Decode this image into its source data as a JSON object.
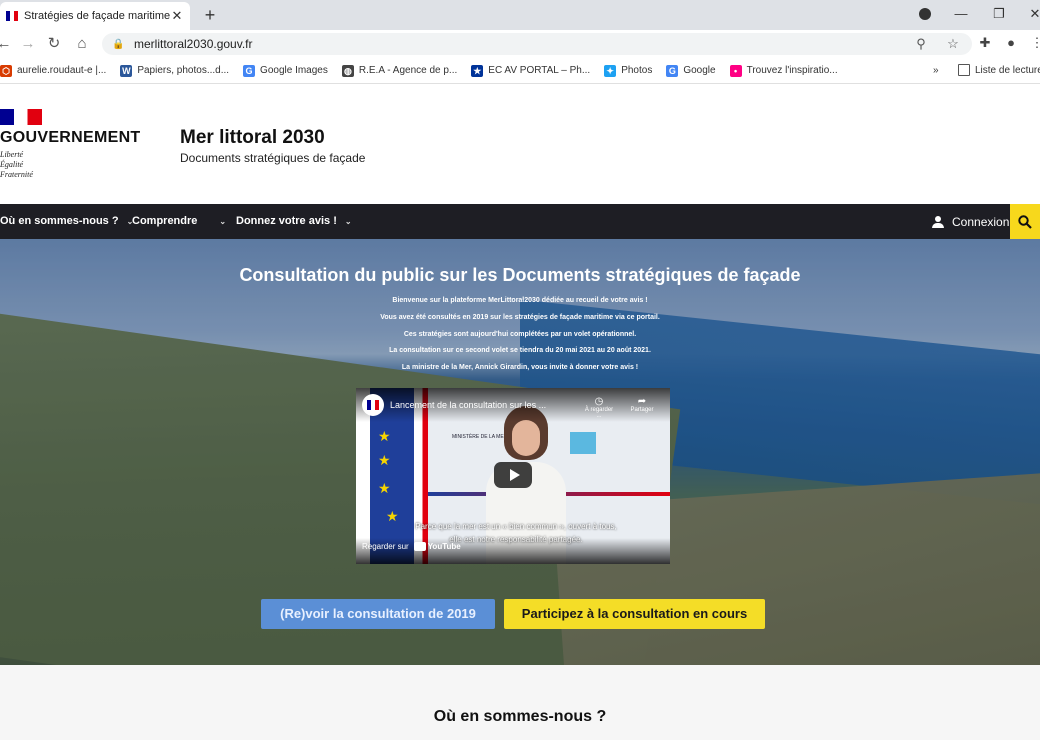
{
  "browser": {
    "tab_title": "Stratégies de façade maritime |",
    "tab_close": "✕",
    "new_tab": "+",
    "url": "merlittoral2030.gouv.fr",
    "bookmarks": [
      {
        "label": "aurelie.roudaut-e |...",
        "icon": "outlook-icon",
        "color": "#d83b01",
        "glyph": "⬡"
      },
      {
        "label": "Papiers, photos...d...",
        "icon": "word-icon",
        "color": "#2b579a",
        "glyph": "W"
      },
      {
        "label": "Google Images",
        "icon": "google-icon",
        "color": "#4285f4",
        "glyph": "G"
      },
      {
        "label": "R.E.A - Agence de p...",
        "icon": "globe-icon",
        "color": "#444444",
        "glyph": "◍"
      },
      {
        "label": "EC AV PORTAL – Ph...",
        "icon": "eu-icon",
        "color": "#003399",
        "glyph": "★"
      },
      {
        "label": "Photos",
        "icon": "twitter-icon",
        "color": "#1da1f2",
        "glyph": "✦"
      },
      {
        "label": "Google",
        "icon": "google-icon",
        "color": "#4285f4",
        "glyph": "G"
      },
      {
        "label": "Trouvez l'inspiratio...",
        "icon": "flickr-icon",
        "color": "#ff0084",
        "glyph": "•"
      }
    ],
    "bookmarks_more": "»",
    "reading_list": "Liste de lecture"
  },
  "header": {
    "gov_name": "GOUVERNEMENT",
    "motto_1": "Liberté",
    "motto_2": "Égalité",
    "motto_3": "Fraternité",
    "site_title": "Mer littoral 2030",
    "site_subtitle": "Documents stratégiques de façade"
  },
  "nav": {
    "items": [
      "Où en sommes-nous ?",
      "Comprendre",
      "Donnez votre avis !"
    ],
    "login": "Connexion"
  },
  "hero": {
    "title": "Consultation du public sur les Documents stratégiques de façade",
    "lines": [
      "Bienvenue sur la plateforme MerLittoral2030 dédiée au recueil de votre avis !",
      "Vous avez été consultés en 2019 sur les stratégies de façade maritime via ce portail.",
      "Ces stratégies sont aujourd'hui complétées par un volet opérationnel.",
      "La consultation sur ce second volet se tiendra du 20 mai 2021 au 20 août 2021.",
      "La ministre de la Mer, Annick Girardin, vous invite à donner votre avis !"
    ],
    "video": {
      "title": "Lancement de la consultation sur les ...",
      "watch_later": "À regarder ...",
      "share": "Partager",
      "ministry": "MINISTÈRE DE LA MER",
      "caption_1": "Parce que la mer est un « bien commun », ouvert à tous,",
      "caption_2": "elle est notre responsabilité partagée.",
      "watch_on": "Regarder sur",
      "youtube": "YouTube"
    },
    "btn_2019": "(Re)voir la consultation de 2019",
    "btn_current": "Participez à la consultation en cours"
  },
  "section": {
    "title": "Où en sommes-nous ?"
  },
  "colors": {
    "navbar": "#1e1e24",
    "accent_yellow": "#f4dd27",
    "button_blue": "#5b8fd6"
  }
}
